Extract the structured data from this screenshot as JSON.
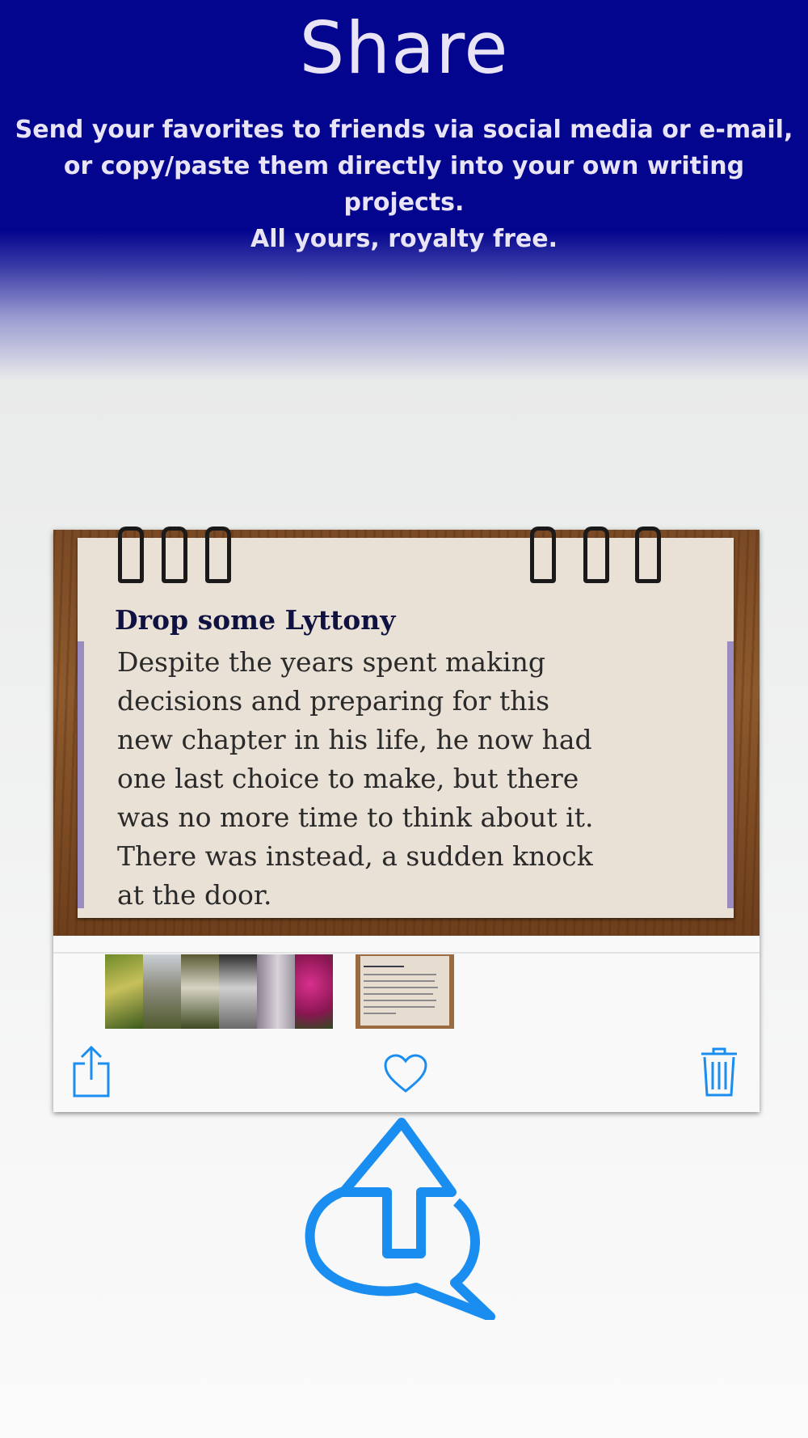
{
  "header": {
    "title": "Share",
    "subtitle_lines": [
      "Send your favorites to friends via social media or e-mail,",
      "or copy/paste them directly into your own writing projects.",
      "All yours, royalty free."
    ]
  },
  "screenshot": {
    "note": {
      "title": "Drop some Lyttony",
      "body_lines": [
        "Despite the years spent making",
        "decisions and preparing for this",
        "new chapter in his life, he now had",
        "one last choice to make, but there",
        "was no more time to think about it.",
        "There was instead, a sudden knock",
        "at the door."
      ]
    },
    "toolbar": {
      "share_icon": "share-icon",
      "favorite_icon": "heart-icon",
      "delete_icon": "trash-icon"
    }
  },
  "colors": {
    "header_bg": "#04058e",
    "header_text": "#e8e4f6",
    "accent_blue": "#1a8df0"
  }
}
